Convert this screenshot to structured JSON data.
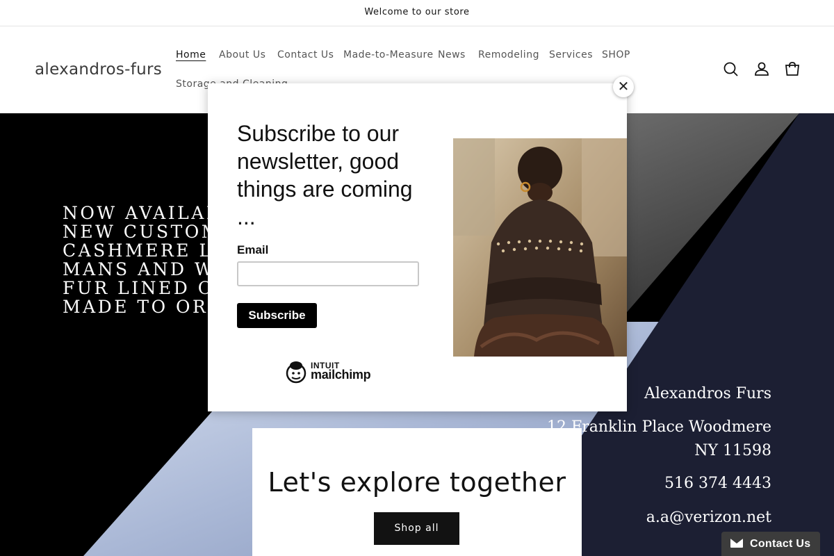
{
  "announcement": {
    "text": "Welcome to our store"
  },
  "header": {
    "logo": "alexandros-furs",
    "nav": [
      {
        "label": "Home",
        "active": true
      },
      {
        "label": "About Us"
      },
      {
        "label": "Contact Us"
      },
      {
        "label": "Made-to-Measure"
      },
      {
        "label": "News"
      },
      {
        "label": "Remodeling"
      },
      {
        "label": "Services"
      },
      {
        "label": "SHOP"
      },
      {
        "label": "Storage and Cleaning"
      }
    ],
    "icons": [
      "search-icon",
      "account-icon",
      "cart-icon"
    ]
  },
  "hero": {
    "lines": [
      "NOW AVAILABLE",
      "NEW CUSTOM",
      "CASHMERE LINED",
      "MANS AND WOMENS",
      "FUR LINED COATS",
      "MADE TO ORDER"
    ],
    "contact": {
      "name": "Alexandros Furs",
      "address_line1": "12 Franklin Place Woodmere",
      "address_line2": "NY 11598",
      "phone": "516 374 4443",
      "email": "a.a@verizon.net"
    },
    "colors": {
      "left_panel": "#000000",
      "right_panel": "#1c1f33",
      "accent": "#121212"
    }
  },
  "explore": {
    "title": "Let's explore together",
    "button": "Shop all"
  },
  "chat": {
    "label": "Contact Us",
    "icon": "envelope-icon"
  },
  "modal": {
    "title": "Subscribe to our newsletter, good things are coming ...",
    "email_label": "Email",
    "email_value": "",
    "subscribe_label": "Subscribe",
    "brand_line1": "INTUIT",
    "brand_line2": "mailchimp",
    "close_icon": "close-icon"
  }
}
